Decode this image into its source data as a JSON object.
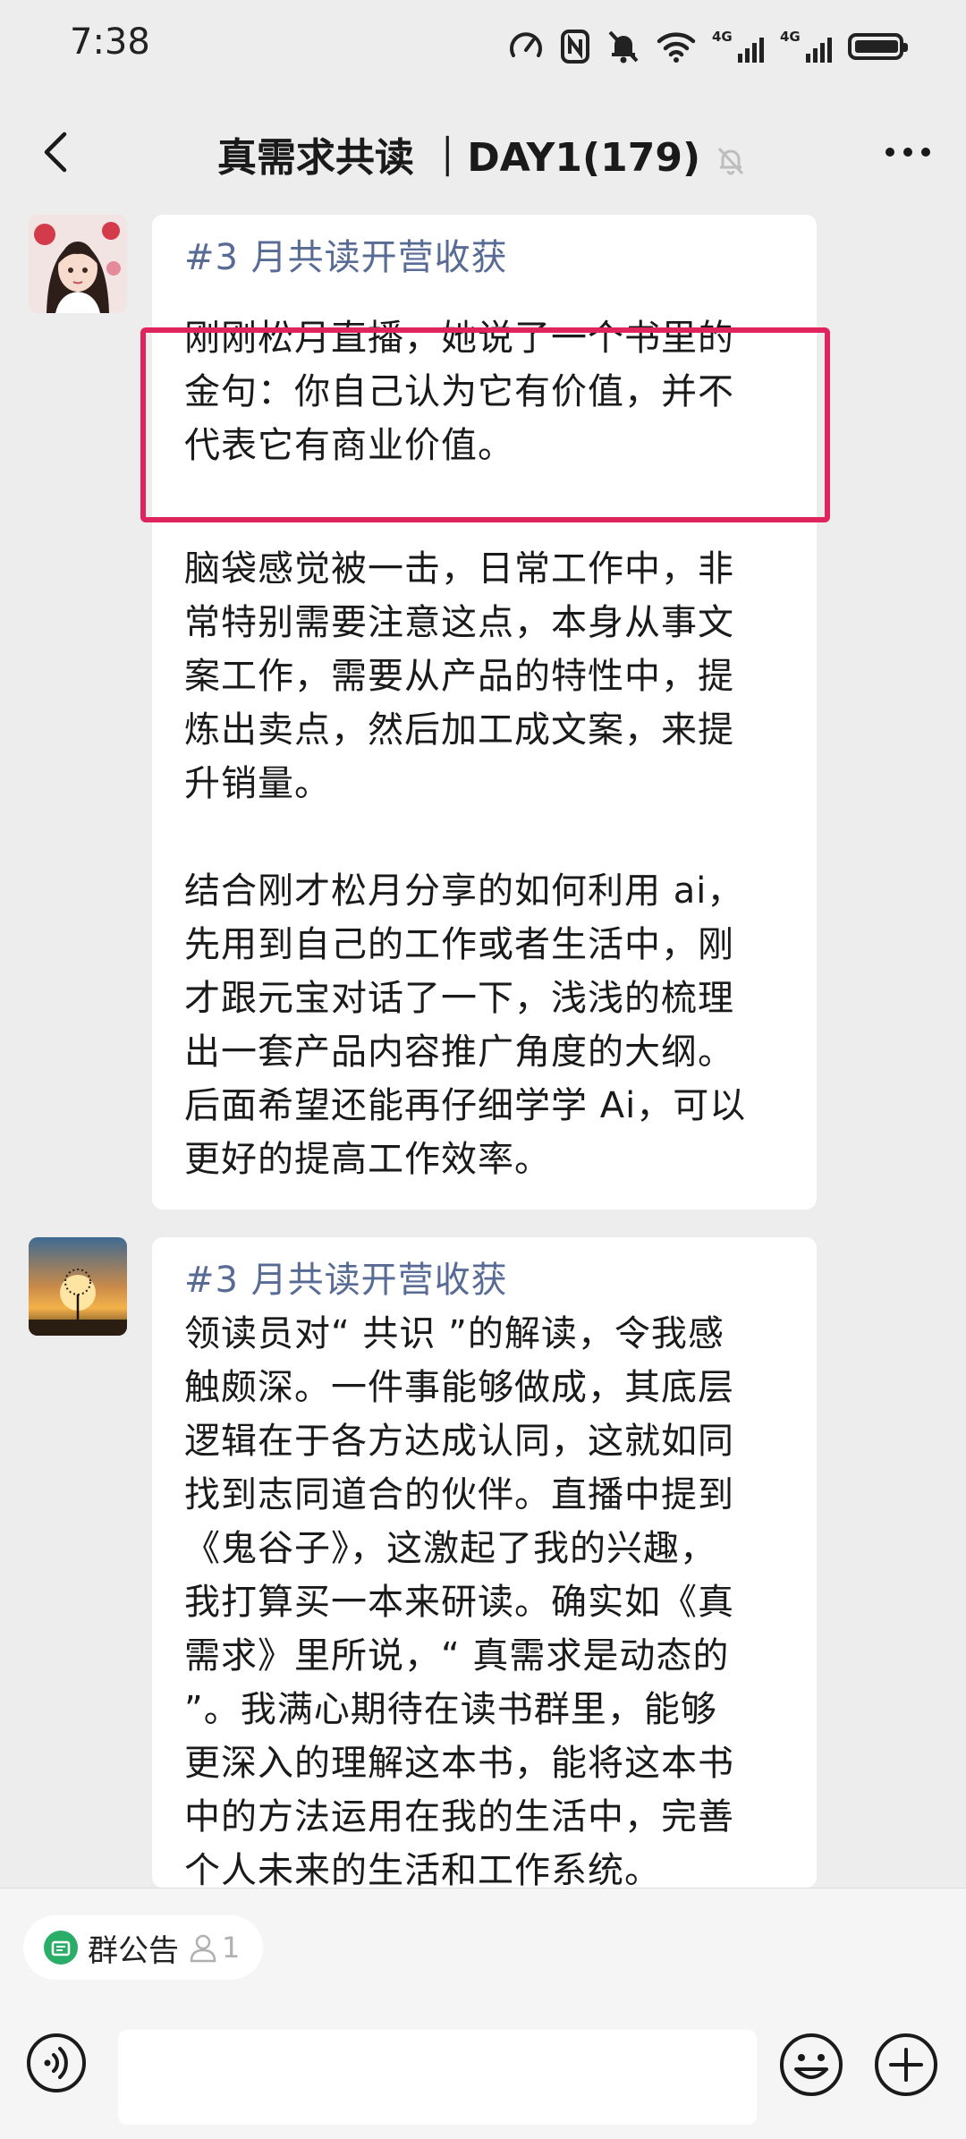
{
  "status_bar": {
    "time": "7:38",
    "network_labels": [
      "4G",
      "4G"
    ]
  },
  "nav": {
    "title": "真需求共读 ｜DAY1(179)"
  },
  "messages": [
    {
      "hashtag": "#3 月共读开营收获",
      "highlight": "刚刚松月直播，她说了一个书里的\n金句：你自己认为它有价值，并不\n代表它有商业价值。",
      "body": "脑袋感觉被一击，日常工作中，非\n常特别需要注意这点，本身从事文\n案工作，需要从产品的特性中，提\n炼出卖点，然后加工成文案，来提\n升销量。\n\n结合刚才松月分享的如何利用 ai，\n先用到自己的工作或者生活中，刚\n才跟元宝对话了一下，浅浅的梳理\n出一套产品内容推广角度的大纲。\n后面希望还能再仔细学学 Ai，可以\n更好的提高工作效率。"
    },
    {
      "hashtag": "#3 月共读开营收获",
      "body": "领读员对“ 共识 ”的解读，令我感\n触颇深。一件事能够做成，其底层\n逻辑在于各方达成认同，这就如同\n找到志同道合的伙伴。直播中提到\n《鬼谷子》，这激起了我的兴趣，\n我打算买一本来研读。确实如《真\n需求》里所说，“ 真需求是动态的\n”。我满心期待在读书群里，能够\n更深入的理解这本书，能将这本书\n中的方法运用在我的生活中，完善\n个人未来的生活和工作系统。"
    }
  ],
  "group_notice": {
    "label": "群公告",
    "count": "1"
  },
  "input": {
    "placeholder": ""
  },
  "colors": {
    "hashtag": "#576b95",
    "highlight_border": "#e0245e",
    "background": "#ededed"
  }
}
